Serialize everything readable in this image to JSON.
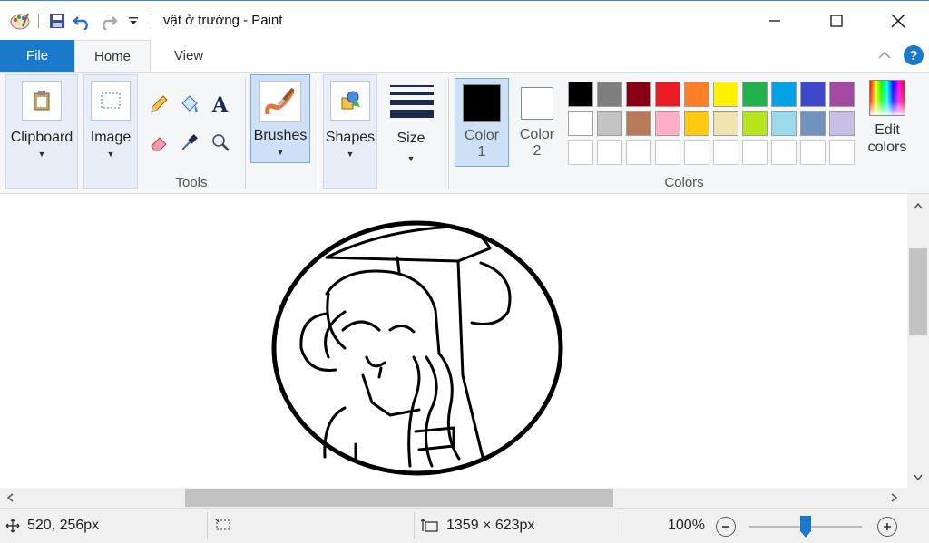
{
  "window": {
    "title": "vật ở trường - Paint"
  },
  "tabs": [
    {
      "label": "File"
    },
    {
      "label": "Home"
    },
    {
      "label": "View"
    }
  ],
  "ribbon": {
    "clipboard": {
      "label": "Clipboard"
    },
    "image": {
      "label": "Image"
    },
    "tools": {
      "label": "Tools"
    },
    "brushes": {
      "label": "Brushes"
    },
    "shapes": {
      "label": "Shapes"
    },
    "size": {
      "label": "Size"
    },
    "color1": {
      "label_line1": "Color",
      "label_line2": "1",
      "value": "#000000"
    },
    "color2": {
      "label_line1": "Color",
      "label_line2": "2",
      "value": "#ffffff"
    },
    "colors_group": {
      "label": "Colors"
    },
    "edit_colors": {
      "label_line1": "Edit",
      "label_line2": "colors"
    },
    "palette": [
      "#000000",
      "#7f7f7f",
      "#880015",
      "#ed1c24",
      "#ff7f27",
      "#fff200",
      "#22b14c",
      "#00a2e8",
      "#3f48cc",
      "#a349a4",
      "#ffffff",
      "#c3c3c3",
      "#b97a57",
      "#ffaec9",
      "#ffc90e",
      "#efe4b0",
      "#b5e61d",
      "#99d9ea",
      "#7092be",
      "#c8bfe7",
      "#ffffff",
      "#ffffff",
      "#ffffff",
      "#ffffff",
      "#ffffff",
      "#ffffff",
      "#ffffff",
      "#ffffff",
      "#ffffff",
      "#ffffff"
    ]
  },
  "status": {
    "cursor_position": "520, 256px",
    "selection_size": "",
    "image_size": "1359 × 623px",
    "zoom": "100%"
  },
  "icons": {
    "paint": "paint-app-icon",
    "save": "save-icon",
    "undo": "undo-icon",
    "redo": "redo-icon"
  }
}
